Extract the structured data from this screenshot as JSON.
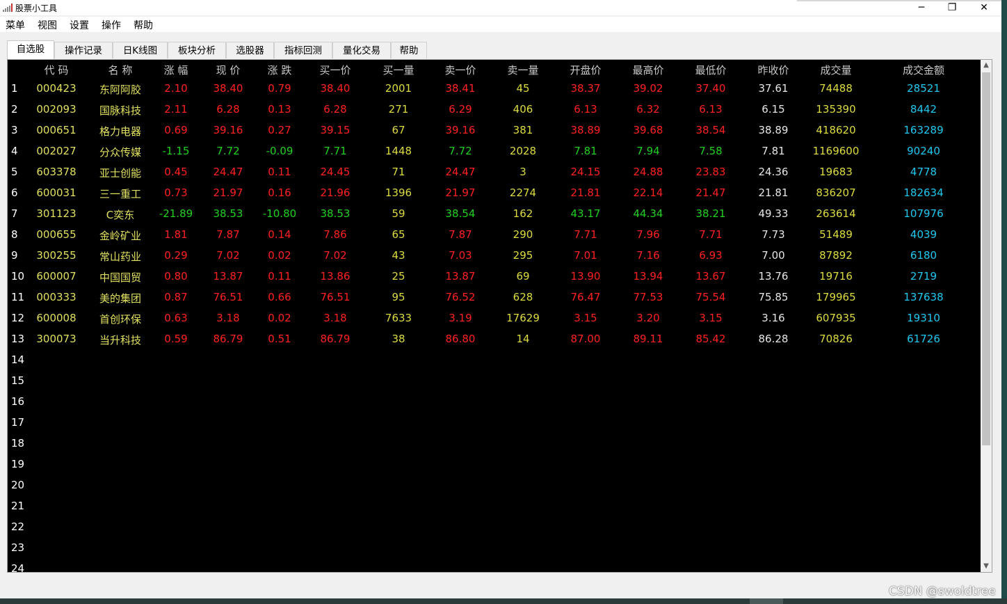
{
  "window": {
    "title": "股票小工具",
    "minimize": "─",
    "restore": "❐",
    "close": "✕"
  },
  "menu": [
    "菜单",
    "视图",
    "设置",
    "操作",
    "帮助"
  ],
  "tabs": [
    "自选股",
    "操作记录",
    "日K线图",
    "板块分析",
    "选股器",
    "指标回测",
    "量化交易",
    "帮助"
  ],
  "active_tab": "自选股",
  "columns": [
    "代 码",
    "名 称",
    "涨 幅",
    "现 价",
    "涨 跌",
    "买一价",
    "买一量",
    "卖一价",
    "卖一量",
    "开盘价",
    "最高价",
    "最低价",
    "昨收价",
    "成交量",
    "成交金额"
  ],
  "colors": {
    "up": "#ff2020",
    "down": "#20d020",
    "code": "#e0e060",
    "volume": "#dcdc40",
    "amount": "#20c8f0",
    "background": "#000000"
  },
  "rows": [
    {
      "n": "1",
      "code": "000423",
      "name": "东阿阿胶",
      "chg_pct": "2.10",
      "price": "38.40",
      "chg": "0.79",
      "bid": "38.40",
      "bid_vol": "2001",
      "ask": "38.41",
      "ask_vol": "45",
      "open": "38.37",
      "high": "39.02",
      "low": "37.40",
      "prev": "37.61",
      "volume": "74488",
      "amount": "28521",
      "dir": "up",
      "open_dir": "up",
      "high_dir": "up",
      "low_dir": "down_red"
    },
    {
      "n": "2",
      "code": "002093",
      "name": "国脉科技",
      "chg_pct": "2.11",
      "price": "6.28",
      "chg": "0.13",
      "bid": "6.28",
      "bid_vol": "271",
      "ask": "6.29",
      "ask_vol": "406",
      "open": "6.13",
      "high": "6.32",
      "low": "6.13",
      "prev": "6.15",
      "volume": "135390",
      "amount": "8442",
      "dir": "up"
    },
    {
      "n": "3",
      "code": "000651",
      "name": "格力电器",
      "chg_pct": "0.69",
      "price": "39.16",
      "chg": "0.27",
      "bid": "39.15",
      "bid_vol": "67",
      "ask": "39.16",
      "ask_vol": "381",
      "open": "38.89",
      "high": "39.68",
      "low": "38.54",
      "prev": "38.89",
      "volume": "418620",
      "amount": "163289",
      "dir": "up"
    },
    {
      "n": "4",
      "code": "002027",
      "name": "分众传媒",
      "chg_pct": "-1.15",
      "price": "7.72",
      "chg": "-0.09",
      "bid": "7.71",
      "bid_vol": "1448",
      "ask": "7.72",
      "ask_vol": "2028",
      "open": "7.81",
      "high": "7.94",
      "low": "7.58",
      "prev": "7.81",
      "volume": "1169600",
      "amount": "90240",
      "dir": "down"
    },
    {
      "n": "5",
      "code": "603378",
      "name": "亚士创能",
      "chg_pct": "0.45",
      "price": "24.47",
      "chg": "0.11",
      "bid": "24.45",
      "bid_vol": "71",
      "ask": "24.47",
      "ask_vol": "3",
      "open": "24.15",
      "high": "24.88",
      "low": "23.83",
      "prev": "24.36",
      "volume": "19683",
      "amount": "4778",
      "dir": "up"
    },
    {
      "n": "6",
      "code": "600031",
      "name": "三一重工",
      "chg_pct": "0.73",
      "price": "21.97",
      "chg": "0.16",
      "bid": "21.96",
      "bid_vol": "1396",
      "ask": "21.97",
      "ask_vol": "2274",
      "open": "21.81",
      "high": "22.14",
      "low": "21.47",
      "prev": "21.81",
      "volume": "836207",
      "amount": "182634",
      "dir": "up"
    },
    {
      "n": "7",
      "code": "301123",
      "name": "C奕东",
      "chg_pct": "-21.89",
      "price": "38.53",
      "chg": "-10.80",
      "bid": "38.53",
      "bid_vol": "59",
      "ask": "38.54",
      "ask_vol": "162",
      "open": "43.17",
      "high": "44.34",
      "low": "38.21",
      "prev": "49.33",
      "volume": "263614",
      "amount": "107976",
      "dir": "down"
    },
    {
      "n": "8",
      "code": "000655",
      "name": "金岭矿业",
      "chg_pct": "1.81",
      "price": "7.87",
      "chg": "0.14",
      "bid": "7.86",
      "bid_vol": "65",
      "ask": "7.87",
      "ask_vol": "290",
      "open": "7.71",
      "high": "7.96",
      "low": "7.71",
      "prev": "7.73",
      "volume": "51489",
      "amount": "4039",
      "dir": "up"
    },
    {
      "n": "9",
      "code": "300255",
      "name": "常山药业",
      "chg_pct": "0.29",
      "price": "7.02",
      "chg": "0.02",
      "bid": "7.02",
      "bid_vol": "43",
      "ask": "7.03",
      "ask_vol": "295",
      "open": "7.01",
      "high": "7.16",
      "low": "6.93",
      "prev": "7.00",
      "volume": "87892",
      "amount": "6180",
      "dir": "up"
    },
    {
      "n": "10",
      "code": "600007",
      "name": "中国国贸",
      "chg_pct": "0.80",
      "price": "13.87",
      "chg": "0.11",
      "bid": "13.86",
      "bid_vol": "25",
      "ask": "13.87",
      "ask_vol": "69",
      "open": "13.90",
      "high": "13.94",
      "low": "13.67",
      "prev": "13.76",
      "volume": "19716",
      "amount": "2719",
      "dir": "up"
    },
    {
      "n": "11",
      "code": "000333",
      "name": "美的集团",
      "chg_pct": "0.87",
      "price": "76.51",
      "chg": "0.66",
      "bid": "76.51",
      "bid_vol": "95",
      "ask": "76.52",
      "ask_vol": "628",
      "open": "76.47",
      "high": "77.53",
      "low": "75.54",
      "prev": "75.85",
      "volume": "179965",
      "amount": "137638",
      "dir": "up"
    },
    {
      "n": "12",
      "code": "600008",
      "name": "首创环保",
      "chg_pct": "0.63",
      "price": "3.18",
      "chg": "0.02",
      "bid": "3.18",
      "bid_vol": "7633",
      "ask": "3.19",
      "ask_vol": "17629",
      "open": "3.15",
      "high": "3.20",
      "low": "3.15",
      "prev": "3.16",
      "volume": "607935",
      "amount": "19310",
      "dir": "up"
    },
    {
      "n": "13",
      "code": "300073",
      "name": "当升科技",
      "chg_pct": "0.59",
      "price": "86.79",
      "chg": "0.51",
      "bid": "86.79",
      "bid_vol": "38",
      "ask": "86.80",
      "ask_vol": "14",
      "open": "87.00",
      "high": "89.11",
      "low": "85.42",
      "prev": "86.28",
      "volume": "70826",
      "amount": "61726",
      "dir": "up"
    }
  ],
  "empty_rows": [
    "14",
    "15",
    "16",
    "17",
    "18",
    "19",
    "20",
    "21",
    "22",
    "23",
    "24"
  ],
  "scroll": {
    "up": "▲",
    "down": "▼"
  },
  "watermark": "CSDN @swoldtree"
}
